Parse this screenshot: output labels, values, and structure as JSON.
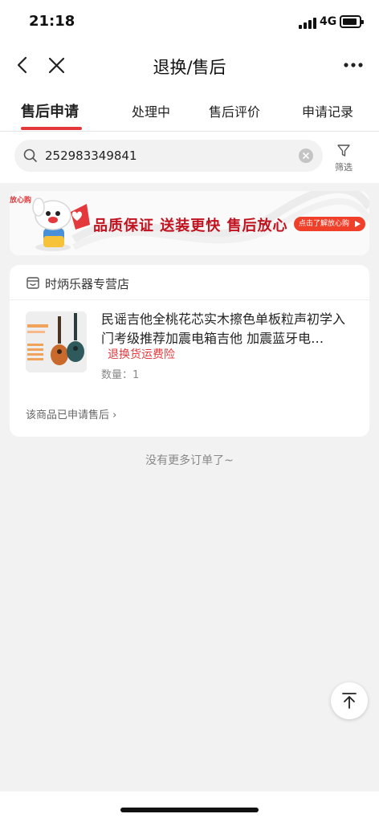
{
  "status_bar": {
    "time": "21:18",
    "network": "4G"
  },
  "nav": {
    "title": "退换/售后"
  },
  "tabs": [
    {
      "label": "售后申请",
      "active": true
    },
    {
      "label": "处理中",
      "active": false
    },
    {
      "label": "售后评价",
      "active": false
    },
    {
      "label": "申请记录",
      "active": false
    }
  ],
  "search": {
    "value": "252983349841"
  },
  "filter": {
    "label": "筛选"
  },
  "banner": {
    "tag": "放心购",
    "slogan": "品质保证  送装更快  售后放心",
    "cta": "点击了解放心购"
  },
  "order": {
    "shop_name": "时炳乐器专营店",
    "product_title": "民谣吉他全桃花芯实木擦色单板粒声初学入门考级推荐加震电箱吉他 加震蓝牙电…",
    "insurance": "退换货运费险",
    "quantity": "数量：1",
    "after_sale_status": "该商品已申请售后 ›"
  },
  "footer": {
    "no_more": "没有更多订单了~"
  },
  "colors": {
    "accent": "#e4393c",
    "background": "#f2f2f2"
  }
}
